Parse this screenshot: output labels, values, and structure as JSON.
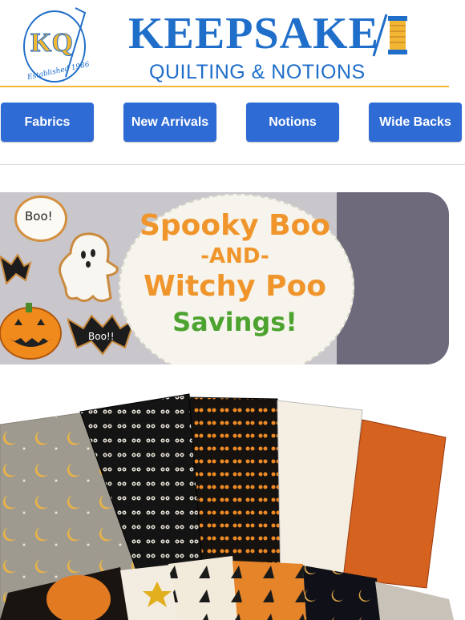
{
  "header": {
    "logo_initials": "KQ",
    "logo_tagline": "Established 1986",
    "brand_title": "KEEPSAKE",
    "brand_subtitle": "QUILTING & NOTIONS"
  },
  "nav": {
    "items": [
      {
        "label": "Fabrics"
      },
      {
        "label": "New Arrivals"
      },
      {
        "label": "Notions"
      },
      {
        "label": "Wide Backs"
      }
    ]
  },
  "banner": {
    "line1": "Spooky Boo",
    "line2": "-AND-",
    "line3": "Witchy Poo",
    "line4": "Savings!",
    "cookie_text_1": "Boo!",
    "cookie_text_2": "Boo!!"
  },
  "colors": {
    "brand_blue": "#1f6ec9",
    "nav_blue": "#2f6bd4",
    "accent_gold": "#f2b632",
    "banner_orange": "#f0952c",
    "banner_green": "#4da32f"
  }
}
